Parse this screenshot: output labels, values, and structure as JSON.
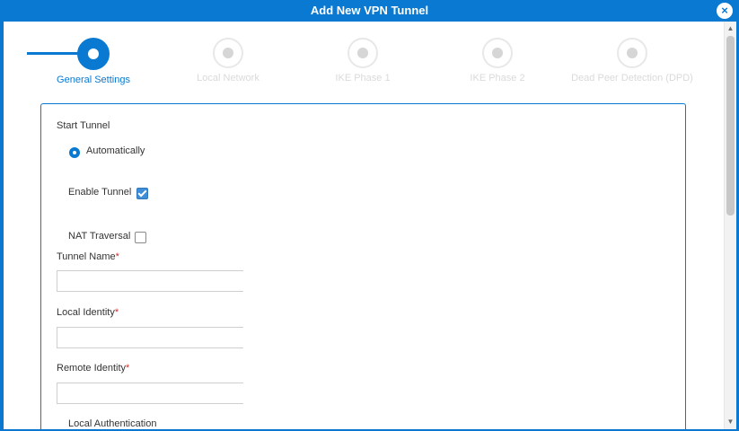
{
  "window": {
    "title": "Add New VPN Tunnel",
    "close_glyph": "×"
  },
  "stepper": {
    "steps": [
      {
        "label": "General Settings",
        "active": true
      },
      {
        "label": "Local Network",
        "active": false
      },
      {
        "label": "IKE Phase 1",
        "active": false
      },
      {
        "label": "IKE Phase 2",
        "active": false
      },
      {
        "label": "Dead Peer Detection (DPD)",
        "active": false
      }
    ]
  },
  "form": {
    "start_tunnel_label": "Start Tunnel",
    "automatically_label": "Automatically",
    "enable_tunnel_label": "Enable Tunnel",
    "enable_tunnel_checked": true,
    "nat_traversal_label": "NAT Traversal",
    "nat_traversal_checked": false,
    "tunnel_name_label": "Tunnel Name",
    "tunnel_name_value": "",
    "local_identity_label": "Local Identity",
    "local_identity_value": "",
    "remote_identity_label": "Remote Identity",
    "remote_identity_value": "",
    "local_authentication_label": "Local Authentication",
    "required_mark": "*"
  },
  "colors": {
    "accent": "#0a79d1",
    "required": "#d32f2f"
  },
  "icons": {
    "close": "close-icon",
    "scroll_up": "chevron-up-icon",
    "scroll_down": "chevron-down-icon"
  }
}
